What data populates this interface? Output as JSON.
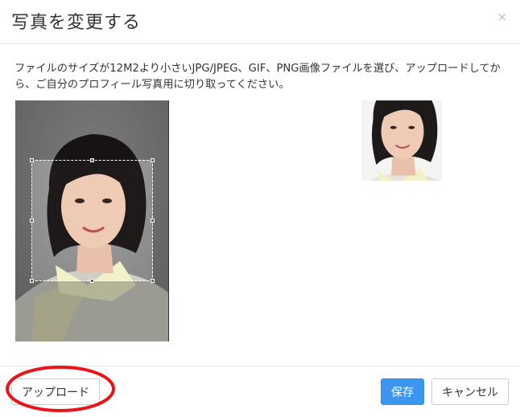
{
  "dialog": {
    "title": "写真を変更する",
    "close_label": "×",
    "description": "ファイルのサイズが12M2より小さいJPG/JPEG、GIF、PNG画像ファイルを選び、アップロードしてから、ご自分のプロフィール写真用に切り取ってください。"
  },
  "footer": {
    "upload_label": "アップロード",
    "save_label": "保存",
    "cancel_label": "キャンセル"
  },
  "colors": {
    "primary": "#3c96f0",
    "annotation": "#e8161c"
  }
}
